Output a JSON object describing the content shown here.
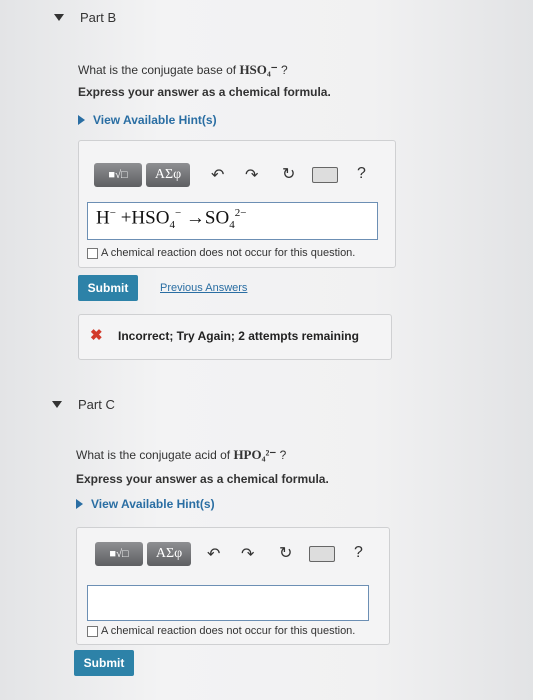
{
  "partB": {
    "title": "Part B",
    "question_prefix": "What is the conjugate base of ",
    "question_formula": "HSO₄⁻",
    "question_suffix": "?",
    "instruction": "Express your answer as a chemical formula.",
    "hint_label": "View Available Hint(s)",
    "toolbar": {
      "template_label": "■√□",
      "greek_label": "AΣφ",
      "help_label": "?"
    },
    "answer": {
      "h": "H",
      "h_charge": "−",
      "plus": "+",
      "hso": "HSO",
      "hso_sub": "4",
      "hso_charge": "−",
      "arrow": "→",
      "so": "SO",
      "so_sub": "4",
      "so_charge": "2−"
    },
    "no_reaction_label": "A chemical reaction does not occur for this question.",
    "submit_label": "Submit",
    "previous_answers_label": "Previous Answers",
    "feedback": {
      "icon": "✖",
      "message": "Incorrect; Try Again; 2 attempts remaining",
      "color": "#d23a2a"
    }
  },
  "partC": {
    "title": "Part C",
    "question_prefix": "What is the conjugate acid of ",
    "question_formula": "HPO₄²⁻",
    "question_suffix": "?",
    "instruction": "Express your answer as a chemical formula.",
    "hint_label": "View Available Hint(s)",
    "toolbar": {
      "template_label": "■√□",
      "greek_label": "AΣφ",
      "help_label": "?"
    },
    "answer_value": "",
    "no_reaction_label": "A chemical reaction does not occur for this question.",
    "submit_label": "Submit"
  },
  "icons": {
    "undo": "undo-icon",
    "redo": "redo-icon",
    "reset": "reset-icon",
    "keyboard": "keyboard-icon"
  },
  "colors": {
    "accent": "#2d82a8",
    "link": "#2a6ea3",
    "error": "#d23a2a"
  }
}
